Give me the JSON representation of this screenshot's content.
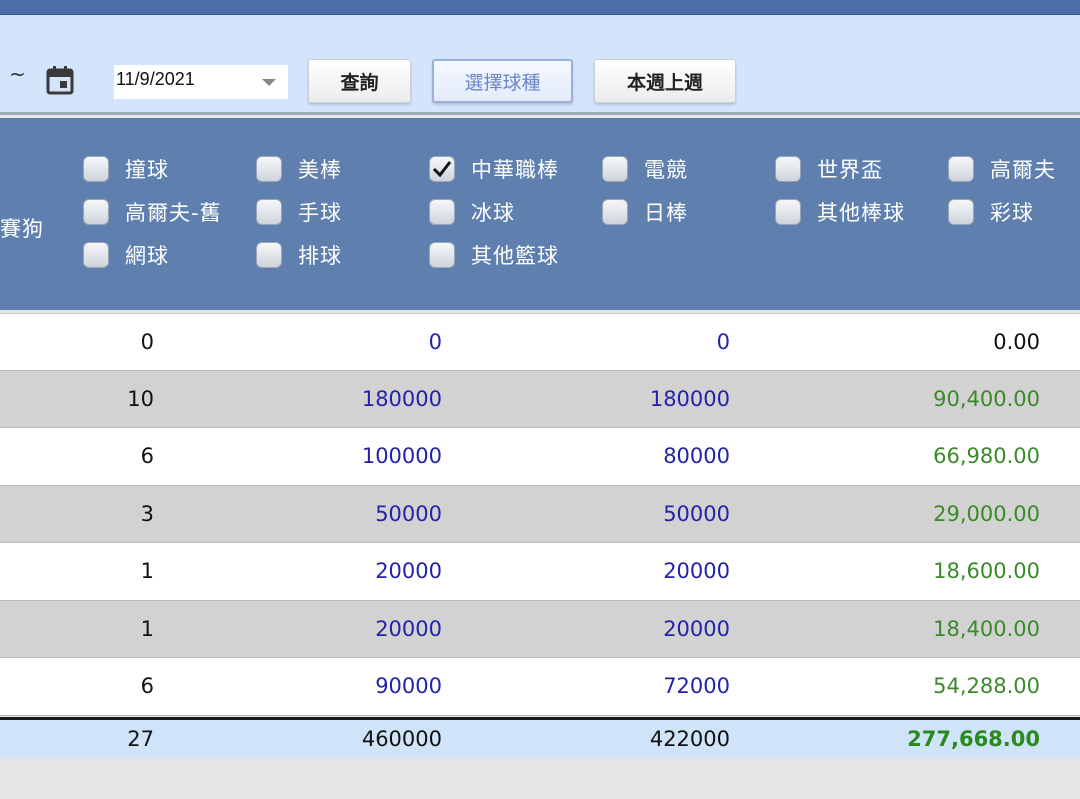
{
  "toolbar": {
    "range_separator": "~",
    "date_value": "11/9/2021",
    "query_label": "查詢",
    "select_sport_label": "選擇球種",
    "week_label": "本週上週"
  },
  "filter": {
    "cut_label": "賽狗",
    "sports": [
      {
        "label": "撞球",
        "checked": false
      },
      {
        "label": "美棒",
        "checked": false
      },
      {
        "label": "中華職棒",
        "checked": true
      },
      {
        "label": "電競",
        "checked": false
      },
      {
        "label": "世界盃",
        "checked": false
      },
      {
        "label": "高爾夫",
        "checked": false
      },
      {
        "label": "高爾夫-舊",
        "checked": false
      },
      {
        "label": "手球",
        "checked": false
      },
      {
        "label": "冰球",
        "checked": false
      },
      {
        "label": "日棒",
        "checked": false
      },
      {
        "label": "其他棒球",
        "checked": false
      },
      {
        "label": "彩球",
        "checked": false
      },
      {
        "label": "網球",
        "checked": false
      },
      {
        "label": "排球",
        "checked": false
      },
      {
        "label": "其他籃球",
        "checked": false
      }
    ]
  },
  "table": {
    "rows": [
      {
        "count": "0",
        "amount": "0",
        "valid": "0",
        "win": "0.00"
      },
      {
        "count": "10",
        "amount": "180000",
        "valid": "180000",
        "win": "90,400.00"
      },
      {
        "count": "6",
        "amount": "100000",
        "valid": "80000",
        "win": "66,980.00"
      },
      {
        "count": "3",
        "amount": "50000",
        "valid": "50000",
        "win": "29,000.00"
      },
      {
        "count": "1",
        "amount": "20000",
        "valid": "20000",
        "win": "18,600.00"
      },
      {
        "count": "1",
        "amount": "20000",
        "valid": "20000",
        "win": "18,400.00"
      },
      {
        "count": "6",
        "amount": "90000",
        "valid": "72000",
        "win": "54,288.00"
      }
    ],
    "total": {
      "count": "27",
      "amount": "460000",
      "valid": "422000",
      "win": "277,668.00"
    }
  },
  "colors": {
    "header_blue": "#5f80af",
    "toolbar_bg": "#d3e4fb",
    "amount_blue": "#2323a8",
    "win_green": "#3a8a2a"
  }
}
